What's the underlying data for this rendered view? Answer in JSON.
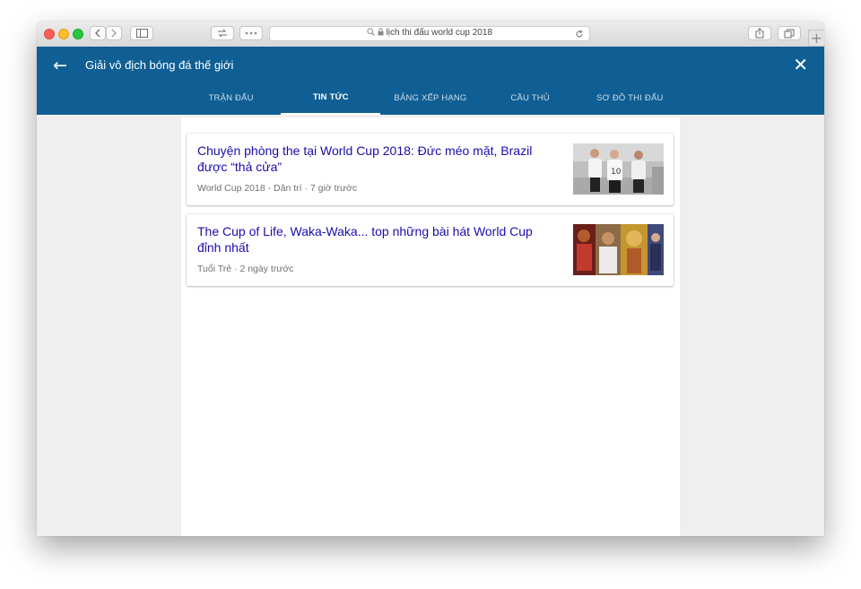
{
  "browser": {
    "address_text": "lịch thi đấu world cup 2018",
    "icons": {
      "back": "chevron-left-icon",
      "forward": "chevron-right-icon",
      "sidebar": "sidebar-icon",
      "tabs": "tabs-icon",
      "more": "more-icon",
      "search": "search-icon",
      "lock": "lock-icon",
      "reload": "reload-icon",
      "share": "share-icon",
      "tab_overview": "tab-overview-icon",
      "new_tab": "plus-icon"
    }
  },
  "header": {
    "title": "Giải vô địch bóng đá thế giới",
    "background": "#0f5f95"
  },
  "tabs": [
    {
      "label": "TRẬN ĐẤU",
      "active": false
    },
    {
      "label": "TIN TỨC",
      "active": true
    },
    {
      "label": "BẢNG XẾP HẠNG",
      "active": false
    },
    {
      "label": "CẦU THỦ",
      "active": false
    },
    {
      "label": "SƠ ĐỒ THI ĐẤU",
      "active": false
    }
  ],
  "news": [
    {
      "title": "Chuyện phòng the tại World Cup 2018: Đức méo mặt, Brazil được “thả cửa”",
      "meta": "World Cup 2018 - Dân trí · 7 giờ trước"
    },
    {
      "title": "The Cup of Life, Waka-Waka... top những bài hát World Cup đỉnh nhất",
      "meta": "Tuổi Trẻ · 2 ngày trước"
    }
  ],
  "colors": {
    "link": "#1a0dab",
    "meta": "#707070",
    "page_bg": "#efefef"
  }
}
